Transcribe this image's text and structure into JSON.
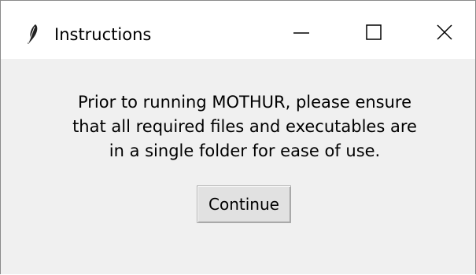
{
  "window": {
    "title": "Instructions",
    "icon": "feather-icon",
    "controls": {
      "minimize": "minimize-icon",
      "maximize": "maximize-icon",
      "close": "close-icon"
    }
  },
  "dialog": {
    "message_lines": [
      "Prior to running MOTHUR, please ensure",
      "that all required files and executables are",
      "in a single folder for ease of use."
    ],
    "continue_label": "Continue"
  }
}
